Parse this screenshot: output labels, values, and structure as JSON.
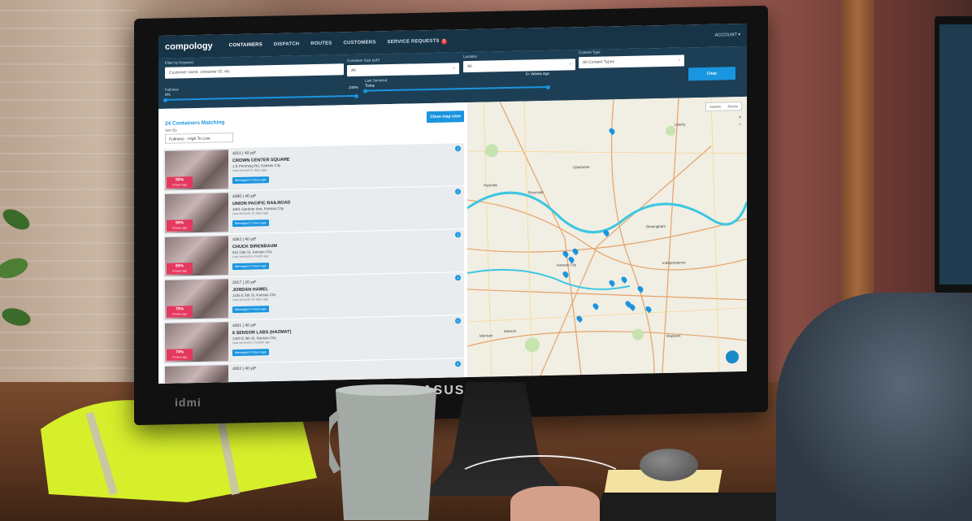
{
  "app": {
    "logo": "compology",
    "nav": [
      "CONTAINERS",
      "DISPATCH",
      "ROUTES",
      "CUSTOMERS",
      "SERVICE REQUESTS"
    ],
    "service_requests_badge": "1",
    "account": "ACCOUNT ▾"
  },
  "filters": {
    "keyword_label": "Filter by Keyword",
    "keyword_placeholder": "Customer name, container ID, etc.",
    "size_label": "Container Size (yd³)",
    "size_value": "All",
    "location_label": "Location",
    "location_value": "All",
    "content_label": "Content Type",
    "content_value": "All Content Types",
    "clear_label": "Clear",
    "fullness_label": "Fullness",
    "fullness_min": "0%",
    "fullness_max": "100%",
    "last_serviced_label": "Last Serviced",
    "last_serviced_min": "Today",
    "last_serviced_max": "6+ Weeks Ago"
  },
  "list": {
    "count_text": "24 Containers Matching",
    "sort_label": "Sort By",
    "sort_value": "Fullness - High To Low",
    "close_map_label": "Close map view",
    "items": [
      {
        "num": "1",
        "id_size": "4011 | 40 yd³",
        "name": "CROWN CENTER SQUARE",
        "address": "1 E Pershing Rd, Kansas City",
        "serviced": "Last serviced 5 days ago",
        "message": "Messaged 4 hours ago",
        "pct": "90%",
        "pct_sub": "4 hours ago"
      },
      {
        "num": "2",
        "id_size": "4080 | 40 yd³",
        "name": "UNION PACIFIC RAILROAD",
        "address": "4801 Gardner Ave, Kansas City",
        "serviced": "Last serviced 15 days ago",
        "message": "Messaged 3 hours ago",
        "pct": "90%",
        "pct_sub": "4 hours ago"
      },
      {
        "num": "3",
        "id_size": "4063 | 40 yd³",
        "name": "CHUCK BIRENBAUM",
        "address": "511 Oak St, Kansas City",
        "serviced": "Last serviced a month ago",
        "message": "Messaged 4 hours ago",
        "pct": "80%",
        "pct_sub": "4 hours ago"
      },
      {
        "num": "4",
        "id_size": "2017 | 20 yd³",
        "name": "JORDAN HAMEL",
        "address": "1155 E 8th St, Kansas City",
        "serviced": "Last serviced 10 days ago",
        "message": "Messaged 4 hours ago",
        "pct": "75%",
        "pct_sub": "4 hours ago"
      },
      {
        "num": "5",
        "id_size": "4001 | 40 yd³",
        "name": "6 SENSOR LABS (HAZMAT)",
        "address": "1400 E 9th St, Kansas City",
        "serviced": "Last serviced 2 months ago",
        "message": "Messaged 4 hours ago",
        "pct": "70%",
        "pct_sub": "4 hours ago"
      },
      {
        "num": "6",
        "id_size": "4003 | 40 yd³",
        "name": "",
        "address": "",
        "serviced": "",
        "message": "",
        "pct": "",
        "pct_sub": ""
      }
    ]
  },
  "map": {
    "satellite": "Satellite",
    "streets": "Streets",
    "places": [
      "Liberty",
      "Gladstone",
      "Independence",
      "Raytown",
      "Birmingham",
      "Parkville",
      "Riverside",
      "Kansas City",
      "Merriam",
      "Mission"
    ]
  },
  "scene": {
    "monitor_brand": "ASUS",
    "brand2": "idmi"
  }
}
